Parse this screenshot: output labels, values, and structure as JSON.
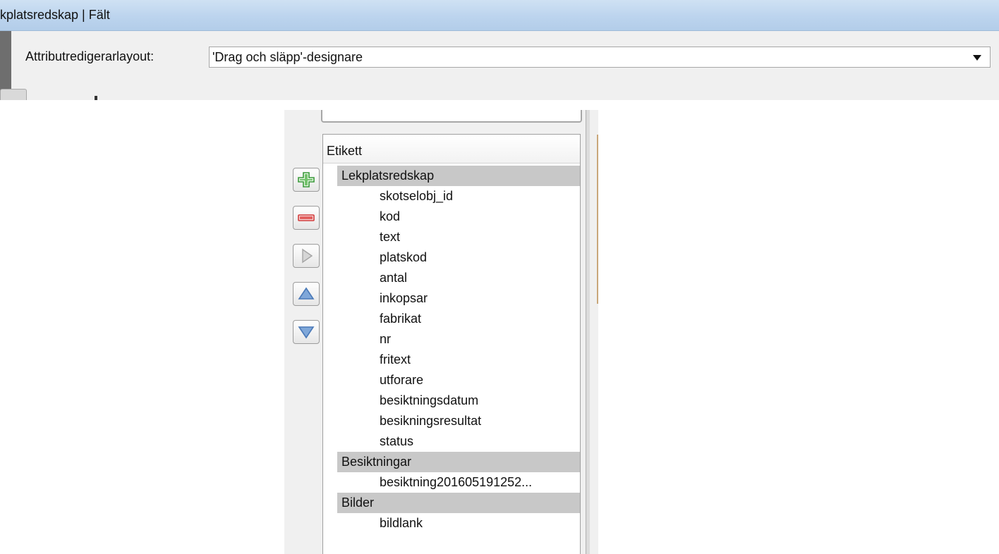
{
  "title_bar": {
    "title": "kplatsredskap | Fält"
  },
  "layout": {
    "label": "Attributredigerarlayout:",
    "selected": "'Drag och släpp'-designare"
  },
  "tree": {
    "header": "Etikett",
    "groups": [
      {
        "name": "Lekplatsredskap",
        "children": [
          "skotselobj_id",
          "kod",
          "text",
          "platskod",
          "antal",
          "inkopsar",
          "fabrikat",
          "nr",
          "fritext",
          "utforare",
          "besiktningsdatum",
          "besikningsresultat",
          "status"
        ]
      },
      {
        "name": "Besiktningar",
        "children": [
          "besiktning201605191252..."
        ]
      },
      {
        "name": "Bilder",
        "children": [
          "bildlank"
        ]
      }
    ]
  },
  "toolbar": {
    "icons": [
      "add-icon",
      "remove-icon",
      "move-right-icon",
      "move-up-icon",
      "move-down-icon"
    ],
    "colors": {
      "add": "#3a9a3a",
      "remove": "#d23c3c",
      "arrow": "#4a79b8",
      "disabled": "#a5a5a5"
    }
  }
}
